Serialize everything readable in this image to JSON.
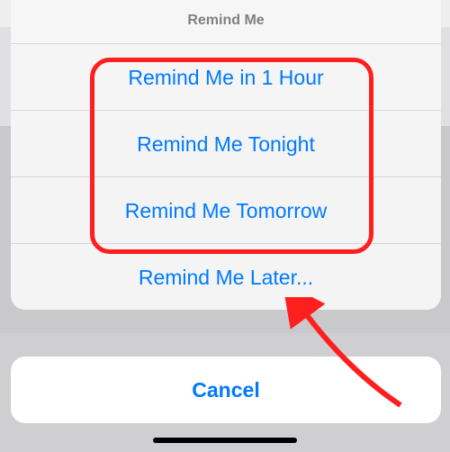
{
  "sheet": {
    "title": "Remind Me",
    "options": [
      "Remind Me in 1 Hour",
      "Remind Me Tonight",
      "Remind Me Tomorrow",
      "Remind Me Later..."
    ]
  },
  "cancel": {
    "label": "Cancel"
  },
  "annotations": {
    "highlight_color": "#ff1f1f",
    "arrow_color": "#ff1f1f"
  }
}
